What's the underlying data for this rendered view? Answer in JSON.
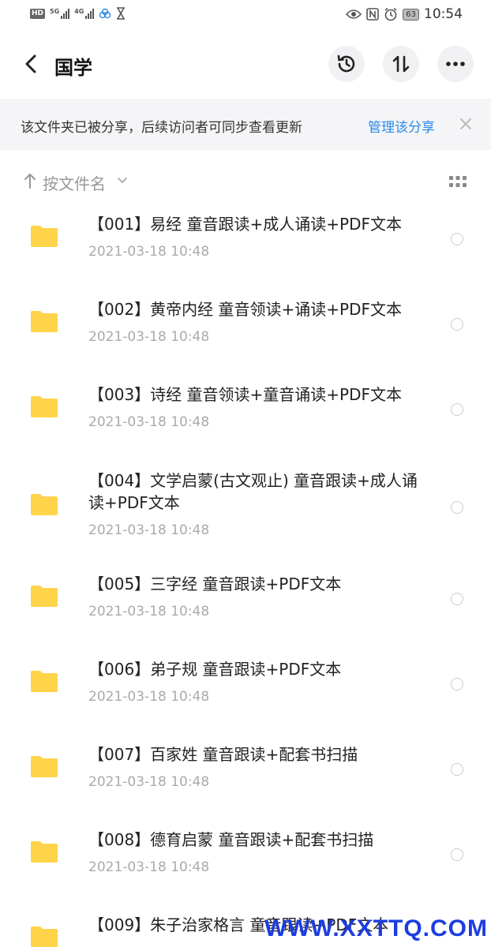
{
  "status_bar": {
    "hd": "HD",
    "net1": "5G",
    "net2": "4G",
    "battery": "63",
    "time": "10:54"
  },
  "header": {
    "title": "国学"
  },
  "banner": {
    "text": "该文件夹已被分享，后续访问者可同步查看更新",
    "link": "管理该分享"
  },
  "sort": {
    "label": "按文件名"
  },
  "files": [
    {
      "name": "【001】易经 童音跟读+成人诵读+PDF文本",
      "date": "2021-03-18  10:48"
    },
    {
      "name": "【002】黄帝内经 童音领读+诵读+PDF文本",
      "date": "2021-03-18  10:48"
    },
    {
      "name": "【003】诗经 童音领读+童音诵读+PDF文本",
      "date": "2021-03-18  10:48"
    },
    {
      "name": "【004】文学启蒙(古文观止) 童音跟读+成人诵读+PDF文本",
      "date": "2021-03-18  10:48"
    },
    {
      "name": "【005】三字经 童音跟读+PDF文本",
      "date": "2021-03-18  10:48"
    },
    {
      "name": "【006】弟子规 童音跟读+PDF文本",
      "date": "2021-03-18  10:48"
    },
    {
      "name": "【007】百家姓 童音跟读+配套书扫描",
      "date": "2021-03-18  10:48"
    },
    {
      "name": "【008】德育启蒙 童音跟读+配套书扫描",
      "date": "2021-03-18  10:48"
    },
    {
      "name": "【009】朱子治家格言 童音跟读+PDF文本",
      "date": ""
    }
  ],
  "watermark": "WWW.XXTTQ.COM",
  "colors": {
    "folder": "#ffd44a",
    "link": "#2a8be6",
    "banner_bg": "#f5f5f7",
    "button_bg": "#f1f1f3",
    "watermark": "#1d3de0"
  }
}
